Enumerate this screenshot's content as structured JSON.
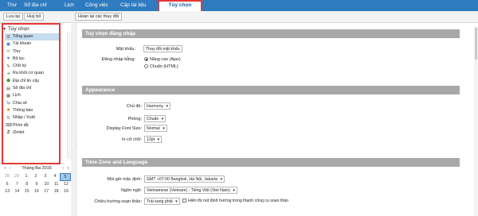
{
  "nav": {
    "tabs": [
      {
        "label": "Thư"
      },
      {
        "label": "Sổ địa chỉ"
      },
      {
        "label": "Lịch"
      },
      {
        "label": "Công việc"
      },
      {
        "label": "Cặp tài liệu"
      },
      {
        "label": "Tùy chọn"
      }
    ]
  },
  "toolbar": {
    "save_label": "Lưu lại",
    "cancel_label": "Huỷ bỏ",
    "revert_label": "Hoàn lại các thay đổi"
  },
  "sidebar": {
    "title": "Tùy chọn",
    "items": [
      {
        "label": "Tổng quan",
        "icon": "gear-icon"
      },
      {
        "label": "Tài khoản",
        "icon": "account-icon"
      },
      {
        "label": "Thư",
        "icon": "mail-icon"
      },
      {
        "label": "Bộ lọc",
        "icon": "filter-icon"
      },
      {
        "label": "Chữ ký",
        "icon": "signature-icon"
      },
      {
        "label": "Ra khỏi cơ quan",
        "icon": "out-of-office-icon"
      },
      {
        "label": "Địa chỉ tin cậy",
        "icon": "trusted-shield-icon"
      },
      {
        "label": "Sổ địa chỉ",
        "icon": "address-book-icon"
      },
      {
        "label": "Lịch",
        "icon": "calendar-icon"
      },
      {
        "label": "Chia sẻ",
        "icon": "share-icon"
      },
      {
        "label": "Thông báo",
        "icon": "notification-icon"
      },
      {
        "label": "Nhập / Xuất",
        "icon": "import-export-icon"
      },
      {
        "label": "Phím tắt",
        "icon": "keyboard-icon"
      },
      {
        "label": "Zimlet",
        "icon": "zimlet-icon"
      }
    ]
  },
  "calendar": {
    "month": "Tháng Ba 2016",
    "prev": "«",
    "prev_month": "‹",
    "next_month": "›",
    "next": "»",
    "rows": [
      [
        "28",
        "29",
        "1",
        "2",
        "3",
        "4",
        "5"
      ],
      [
        "6",
        "7",
        "8",
        "9",
        "10",
        "11",
        "12"
      ],
      [
        "13",
        "14",
        "15",
        "16",
        "17",
        "18",
        "19"
      ]
    ],
    "row0_dim": [
      true,
      true,
      false,
      false,
      false,
      false,
      false
    ],
    "selected": "5"
  },
  "login": {
    "header": "Tuỳ chọn đăng nhập",
    "password_label": "Mật khẩu:",
    "password_button": "Thay đổi mật khẩu",
    "login_using_label": "Đăng nhập bằng:",
    "option_advanced": "Nâng cao (Ajax)",
    "option_standard": "Chuẩn (HTML)"
  },
  "appearance": {
    "header": "Appearance",
    "theme_label": "Chủ đề:",
    "theme_value": "Harmony",
    "font_label": "Phông:",
    "font_value": "Chuẩn",
    "display_size_label": "Display Font Size:",
    "display_size_value": "Normal",
    "print_size_label": "In cỡ chữ:",
    "print_size_value": "12pt"
  },
  "timezone": {
    "header": "Time Zone and Language",
    "default_tz_label": "Múi giờ mặc định:",
    "default_tz_value": "GMT +07:00 Bangkok, Hà Nội, Jakarta",
    "language_label": "Ngôn ngữ:",
    "language_value": "Vietnamese (Vietnam) - Tiếng Việt (Viet Nam)",
    "direction_label": "Chiều hướng soạn thảo:",
    "direction_value": "Trái sang phải",
    "show_direction_label": "Hiển thị nút định hướng trong thanh công cụ soạn thảo"
  },
  "colors": {
    "nav_bg": "#2f7bbf",
    "highlight_red": "#e53935",
    "section_header": "#a8a8a8",
    "selected_item": "#c6dcef"
  }
}
